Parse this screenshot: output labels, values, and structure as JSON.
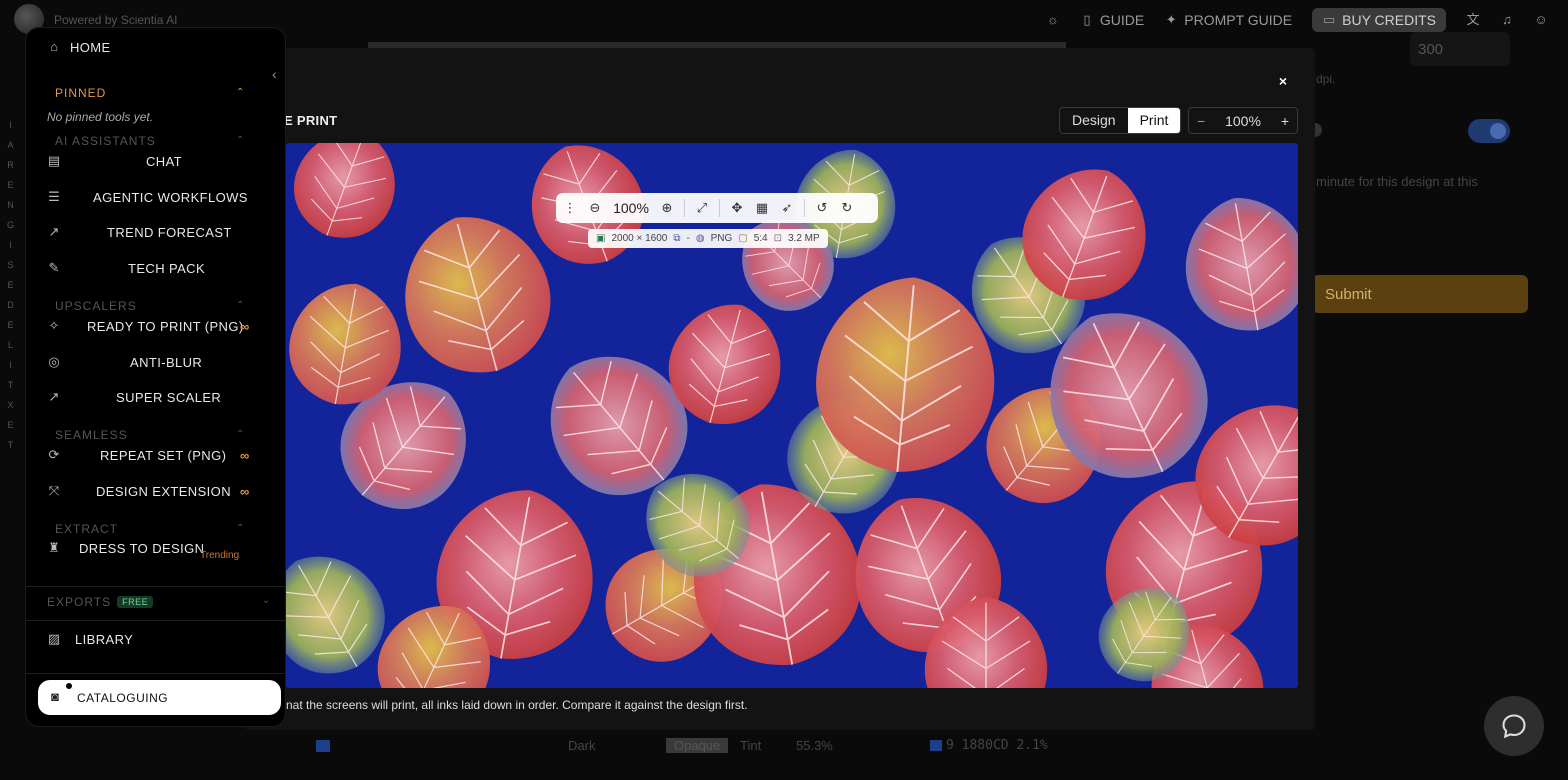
{
  "topbar": {
    "powered": "Powered by Scientia AI",
    "guide": "GUIDE",
    "prompt_guide": "PROMPT GUIDE",
    "buy_credits": "BUY CREDITS"
  },
  "background": {
    "dpi_value": "300",
    "dpi_hint": "dpi.",
    "minute_text": "minute for this design at this",
    "submit": "Submit",
    "bottom_row": {
      "dark": "Dark",
      "opaque": "Opaque",
      "tint": "Tint",
      "percent": "55.3%",
      "color_code": "9  1880CD  2.1%"
    }
  },
  "vertical_text": "TEXTILE DESIGNER AI",
  "modal": {
    "title": "E PRINT",
    "close": "×",
    "toggle": [
      "Design",
      "Print"
    ],
    "active_toggle": "Print",
    "zoom": {
      "minus": "−",
      "value": "100%",
      "plus": "+"
    },
    "caption": "nat the screens will print, all inks laid down in order. Compare it against the design first.",
    "toolbar": {
      "zoom_value": "100%"
    },
    "info": {
      "dimensions": "2000 × 1600",
      "link": "-",
      "format": "PNG",
      "ratio": "5:4",
      "megapixels": "3.2 MP"
    }
  },
  "sidebar": {
    "home": "HOME",
    "pinned": "PINNED",
    "no_pinned": "No pinned tools yet.",
    "sections": {
      "ai_assistants": "AI ASSISTANTS",
      "upscalers": "UPSCALERS",
      "seamless": "SEAMLESS",
      "extract": "EXTRACT",
      "exports": "EXPORTS",
      "exports_badge": "FREE"
    },
    "items": {
      "chat": "CHAT",
      "agentic": "AGENTIC WORKFLOWS",
      "trend": "TREND FORECAST",
      "techpack": "TECH PACK",
      "ready": "READY TO PRINT (PNG)",
      "antiblur": "ANTI-BLUR",
      "superscaler": "SUPER SCALER",
      "repeat": "REPEAT SET (PNG)",
      "extension": "DESIGN EXTENSION",
      "dress": "DRESS TO DESIGN",
      "trending": "Trending",
      "library": "LIBRARY",
      "cataloguing": "CATALOGUING"
    },
    "infinity": "∞"
  },
  "colors": {
    "accent_orange": "#e39745",
    "print_background": "#13239a",
    "submit_bg": "#5b4110"
  }
}
